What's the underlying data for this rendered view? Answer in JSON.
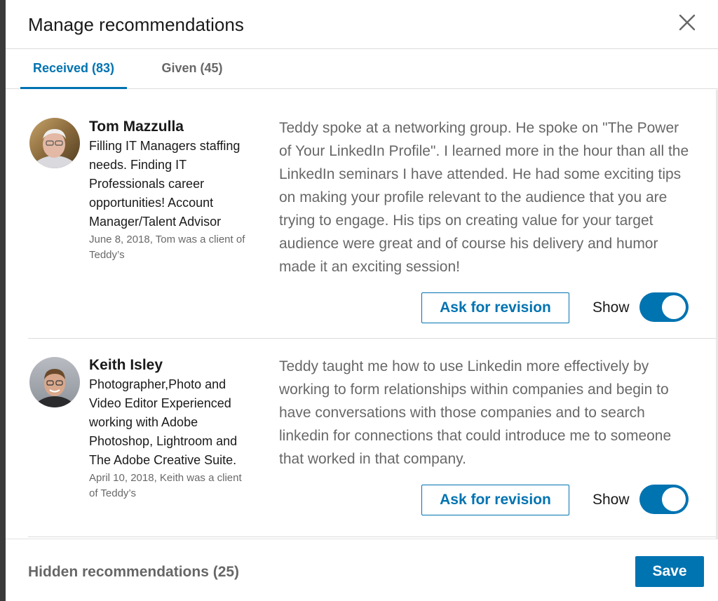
{
  "modal": {
    "title": "Manage recommendations",
    "close_icon": "close-icon"
  },
  "tabs": [
    {
      "label": "Received (83)",
      "selected": true
    },
    {
      "label": "Given (45)",
      "selected": false
    }
  ],
  "recommendations": [
    {
      "name": "Tom Mazzulla",
      "headline": "Filling IT Managers staffing needs. Finding IT Professionals career opportunities! Account Manager/Talent Advisor",
      "meta": "June 8, 2018, Tom was a client of Teddy’s",
      "text": "Teddy spoke at a networking group. He spoke on \"The Power of Your LinkedIn Profile\". I learned more in the hour than all the LinkedIn seminars I have attended. He had some exciting tips on making your profile relevant to the audience that you are trying to engage. His tips on creating value for your target audience were great and of course his delivery and humor made it an exciting session!",
      "revise_label": "Ask for revision",
      "show_label": "Show",
      "show_on": true
    },
    {
      "name": "Keith Isley",
      "headline": "Photographer,Photo and Video Editor Experienced working with Adobe Photoshop, Lightroom and The Adobe Creative Suite.",
      "meta": "April 10, 2018, Keith was a client of Teddy’s",
      "text": "Teddy taught me how to use Linkedin more effectively by working to form relationships within companies and begin to have conversations with those companies and to search linkedin for connections that could introduce me to someone that worked in that company.",
      "revise_label": "Ask for revision",
      "show_label": "Show",
      "show_on": true
    }
  ],
  "footer": {
    "hidden_label": "Hidden recommendations (25)",
    "save_label": "Save"
  },
  "colors": {
    "accent": "#0073b1",
    "divider": "#dcdcdc",
    "backdrop": "#3a3a3a"
  }
}
